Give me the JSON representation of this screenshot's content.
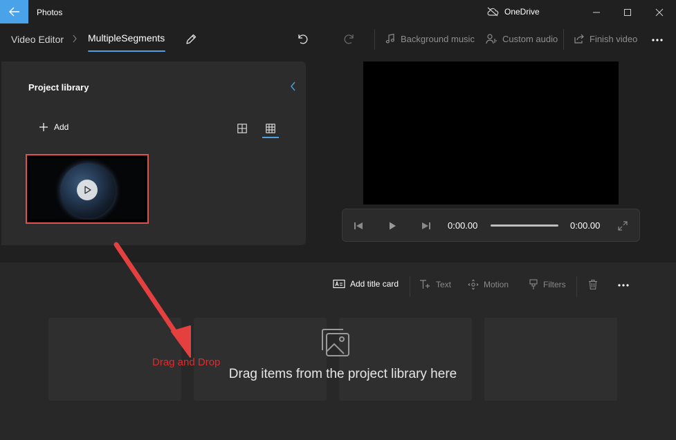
{
  "app": {
    "title": "Photos",
    "cloud_label": "OneDrive"
  },
  "breadcrumb": {
    "root": "Video Editor",
    "current": "MultipleSegments"
  },
  "toolbar": {
    "background_music": "Background music",
    "custom_audio": "Custom audio",
    "finish_video": "Finish video"
  },
  "library": {
    "title": "Project library",
    "add_label": "Add"
  },
  "player": {
    "current_time": "0:00.00",
    "total_time": "0:00.00",
    "progress": 0
  },
  "storyboard": {
    "add_title_card": "Add title card",
    "text": "Text",
    "motion": "Motion",
    "filters": "Filters",
    "empty_message": "Drag items from the project library here"
  },
  "annotation": {
    "label": "Drag and Drop",
    "color": "#e02b2b"
  },
  "colors": {
    "accent": "#4aa3e8",
    "highlight_border": "#e0504e"
  }
}
